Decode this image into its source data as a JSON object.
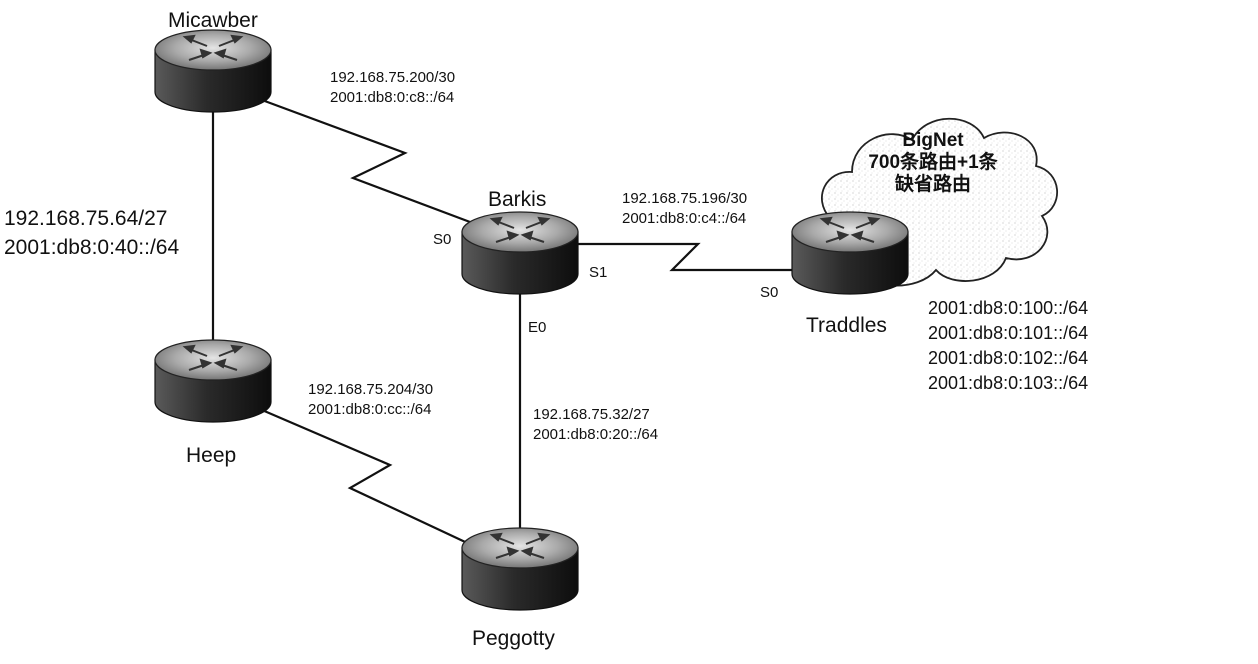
{
  "routers": {
    "micawber": {
      "name": "Micawber"
    },
    "barkis": {
      "name": "Barkis"
    },
    "traddles": {
      "name": "Traddles"
    },
    "heep": {
      "name": "Heep"
    },
    "peggotty": {
      "name": "Peggotty"
    }
  },
  "links": {
    "micawber_barkis": {
      "ipv4": "192.168.75.200/30",
      "ipv6": "2001:db8:0:c8::/64"
    },
    "barkis_traddles": {
      "ipv4": "192.168.75.196/30",
      "ipv6": "2001:db8:0:c4::/64"
    },
    "micawber_heep": {
      "ipv4": "192.168.75.64/27",
      "ipv6": "2001:db8:0:40::/64"
    },
    "heep_peggotty": {
      "ipv4": "192.168.75.204/30",
      "ipv6": "2001:db8:0:cc::/64"
    },
    "barkis_peggotty": {
      "ipv4": "192.168.75.32/27",
      "ipv6": "2001:db8:0:20::/64"
    }
  },
  "interfaces": {
    "barkis_s0": "S0",
    "barkis_s1": "S1",
    "barkis_e0": "E0",
    "traddles_s0": "S0"
  },
  "cloud": {
    "line1": "BigNet",
    "line2": "700条路由+1条",
    "line3": "缺省路由"
  },
  "traddles_prefixes": [
    "2001:db8:0:100::/64",
    "2001:db8:0:101::/64",
    "2001:db8:0:102::/64",
    "2001:db8:0:103::/64"
  ]
}
